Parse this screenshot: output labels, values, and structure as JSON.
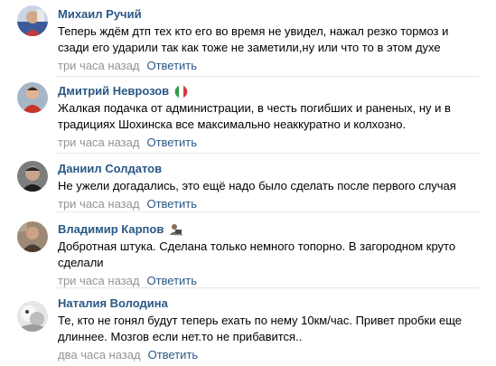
{
  "comments": [
    {
      "author": "Михаил Ручий",
      "text": "Теперь ждём дтп тех кто его во время не увидел, нажал резко тормоз и сзади его ударили так как тоже не заметили,ну или что то в этом духе",
      "time": "три часа назад",
      "reply": "Ответить",
      "badge": "",
      "avatar_color": "#8a6f58"
    },
    {
      "author": "Дмитрий Неврозов",
      "text": "Жалкая подачка от администрации, в честь погибших и раненых, ну и в традициях Шохинска все максимально неаккуратно и колхозно.",
      "time": "три часа назад",
      "reply": "Ответить",
      "badge": "italy-flag-icon",
      "avatar_color": "#b33a2e"
    },
    {
      "author": "Даниил Солдатов",
      "text": "Не ужели догадались, это ещё надо было сделать после первого случая",
      "time": "три часа назад",
      "reply": "Ответить",
      "badge": "",
      "avatar_color": "#555555"
    },
    {
      "author": "Владимир Карпов",
      "text": "Добротная штука. Сделана только немного топорно. В загородном круто сделали",
      "time": "три часа назад",
      "reply": "Ответить",
      "badge": "computer-user-emoji-icon",
      "avatar_color": "#6b5848"
    },
    {
      "author": "Наталия Володина",
      "text": "Те, кто не гонял будут теперь ехать по нему 10км/час. Привет пробки еще длиннее. Мозгов если нет.то не прибавится..",
      "time": "два часа назад",
      "reply": "Ответить",
      "badge": "",
      "avatar_color": "#cfcfcf"
    }
  ]
}
